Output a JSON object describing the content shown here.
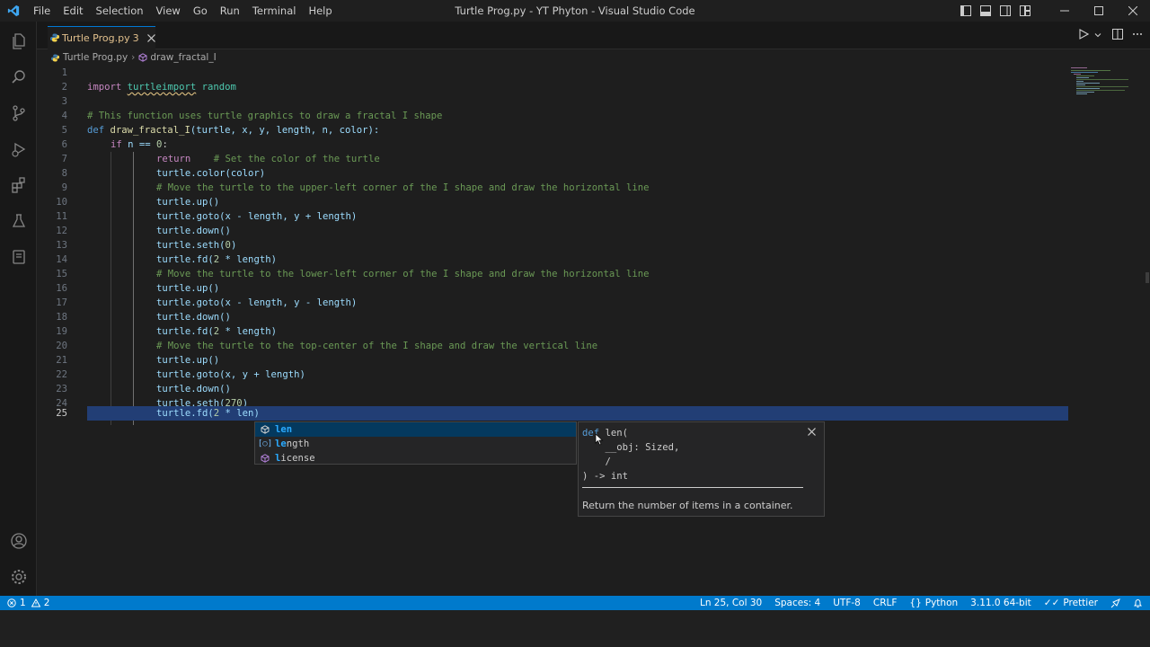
{
  "window": {
    "title": "Turtle Prog.py - YT Phyton - Visual Studio Code",
    "menu": [
      "File",
      "Edit",
      "Selection",
      "View",
      "Go",
      "Run",
      "Terminal",
      "Help"
    ]
  },
  "tab": {
    "name": "Turtle Prog.py",
    "problems": "3"
  },
  "breadcrumb": {
    "file": "Turtle Prog.py",
    "symbol": "draw_fractal_I"
  },
  "editor": {
    "lines": [
      {
        "n": "1"
      },
      {
        "n": "2"
      },
      {
        "n": "3"
      },
      {
        "n": "4"
      },
      {
        "n": "5"
      },
      {
        "n": "6"
      },
      {
        "n": "7"
      },
      {
        "n": "8"
      },
      {
        "n": "9"
      },
      {
        "n": "10"
      },
      {
        "n": "11"
      },
      {
        "n": "12"
      },
      {
        "n": "13"
      },
      {
        "n": "14"
      },
      {
        "n": "15"
      },
      {
        "n": "16"
      },
      {
        "n": "17"
      },
      {
        "n": "18"
      },
      {
        "n": "19"
      },
      {
        "n": "20"
      },
      {
        "n": "21"
      },
      {
        "n": "22"
      },
      {
        "n": "23"
      },
      {
        "n": "24"
      },
      {
        "n": "25"
      }
    ],
    "code": {
      "l2_import": "import",
      "l2_mod": "turtleimport",
      "l2_rest": " random",
      "l4": "# This function uses turtle graphics to draw a fractal I shape",
      "l5_def": "def",
      "l5_fn": "draw_fractal_I",
      "l5_rest": "(turtle, x, y, length, n, color):",
      "l6_if": "if",
      "l6_rest": " n == ",
      "l6_num": "0",
      "l6_colon": ":",
      "l7_ret": "return",
      "l7_cm": "    # Set the color of the turtle",
      "l8": "turtle.color(color)",
      "l9": "# Move the turtle to the upper-left corner of the I shape and draw the horizontal line",
      "l10": "turtle.up()",
      "l11": "turtle.goto(x - length, y + length)",
      "l12": "turtle.down()",
      "l13_a": "turtle.seth(",
      "l13_num": "0",
      "l13_b": ")",
      "l14_a": "turtle.fd(",
      "l14_num": "2",
      "l14_b": " * length)",
      "l15": "# Move the turtle to the lower-left corner of the I shape and draw the horizontal line",
      "l16": "turtle.up()",
      "l17": "turtle.goto(x - length, y - length)",
      "l18": "turtle.down()",
      "l19_a": "turtle.fd(",
      "l19_num": "2",
      "l19_b": " * length)",
      "l20": "# Move the turtle to the top-center of the I shape and draw the vertical line",
      "l21": "turtle.up()",
      "l22": "turtle.goto(x, y + length)",
      "l23": "turtle.down()",
      "l24_a": "turtle.seth(",
      "l24_num": "270",
      "l24_b": ")",
      "l25_a": "turtle.fd(",
      "l25_num": "2",
      "l25_b": " * len)"
    }
  },
  "suggest": {
    "items": [
      {
        "match": "len",
        "rest": ""
      },
      {
        "match": "le",
        "rest": "ngth"
      },
      {
        "match": "l",
        "rest": "icense"
      }
    ]
  },
  "details": {
    "signature_def": "def",
    "signature_line1": " len(",
    "signature_line2": "    __obj: Sized,",
    "signature_line3": "    /",
    "signature_line4": ") -> int",
    "doc": "Return the number of items in a container."
  },
  "status": {
    "errors": "1",
    "warnings": "2",
    "position": "Ln 25, Col 30",
    "spaces": "Spaces: 4",
    "encoding": "UTF-8",
    "eol": "CRLF",
    "language": "Python",
    "interpreter": "3.11.0 64-bit",
    "formatter": "Prettier"
  },
  "colors": {
    "accent": "#007acc",
    "active_line": "#223e75",
    "modified_tab": "#e2c08d"
  }
}
